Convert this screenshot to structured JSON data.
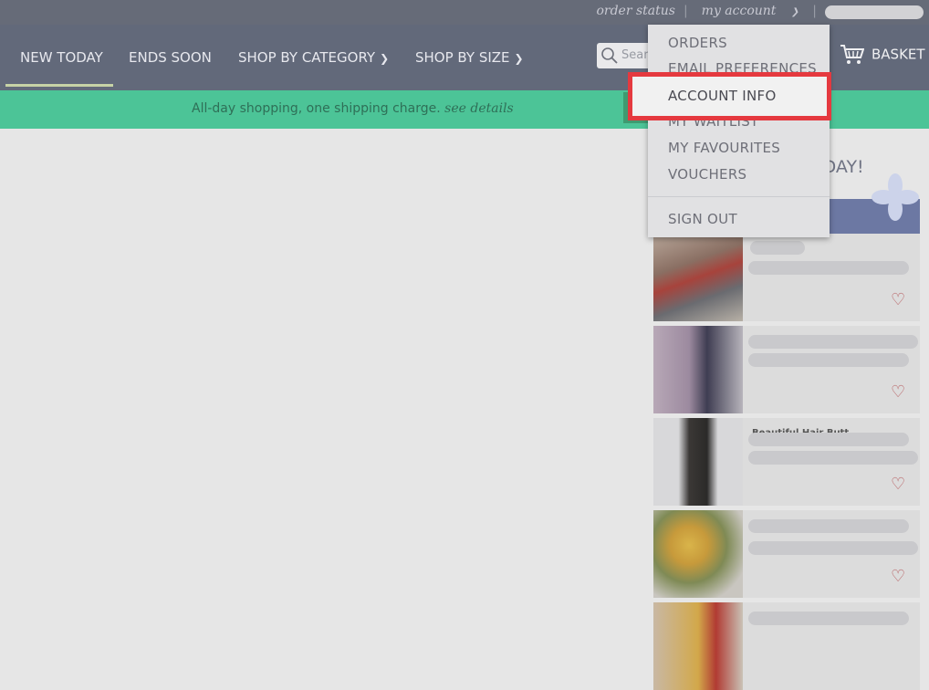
{
  "topbar": {
    "order_status": "order status",
    "my_account": "my account",
    "my_account_chevron": "chevron-down-icon"
  },
  "nav": {
    "items": [
      {
        "label": "NEW TODAY"
      },
      {
        "label": "ENDS SOON"
      },
      {
        "label": "SHOP BY CATEGORY"
      },
      {
        "label": "SHOP BY SIZE"
      }
    ],
    "search_placeholder": "Search",
    "basket_label": "BASKET"
  },
  "promo": {
    "text": "All-day shopping, one shipping charge.",
    "link": "see details"
  },
  "sidebar": {
    "heading_partial": "RY DAY!",
    "cards": [
      {
        "title": ""
      },
      {
        "title": ""
      },
      {
        "title": "Beautiful Hair Butt..."
      },
      {
        "title": ""
      },
      {
        "title": ""
      }
    ]
  },
  "account_menu": {
    "items": [
      {
        "label": "ORDERS"
      },
      {
        "label": "EMAIL PREFERENCES"
      },
      {
        "label": "ACCOUNT INFO"
      },
      {
        "label": "MY WAITLIST"
      },
      {
        "label": "MY FAVOURITES"
      },
      {
        "label": "VOUCHERS"
      },
      {
        "label": "SIGN OUT"
      }
    ],
    "highlighted_index": 2
  },
  "colors": {
    "topbar": "#666b78",
    "navbar": "#62697a",
    "promo_bar": "#4cc497",
    "highlight_border": "#e5393f",
    "heart": "#b5575a"
  }
}
